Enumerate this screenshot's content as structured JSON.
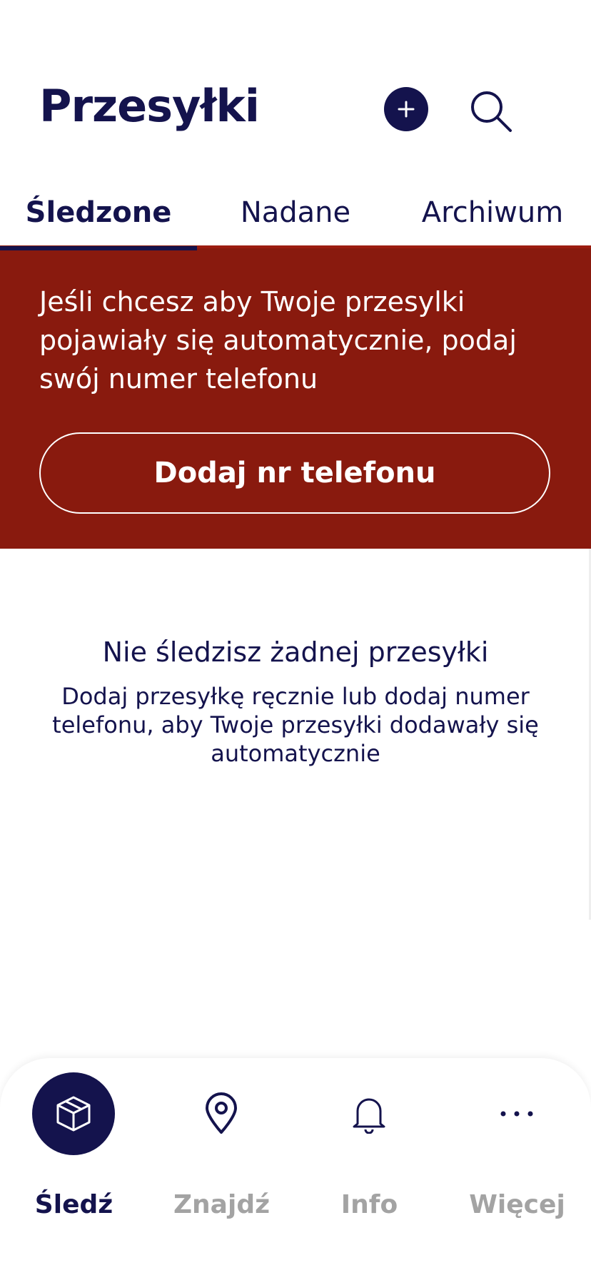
{
  "header": {
    "title": "Przesyłki"
  },
  "tabs": [
    {
      "label": "Śledzone",
      "active": true
    },
    {
      "label": "Nadane",
      "active": false
    },
    {
      "label": "Archiwum",
      "active": false
    }
  ],
  "banner": {
    "text": "Jeśli chcesz aby Twoje przesylki pojawiały się automatycznie, podaj swój numer telefonu",
    "button_label": "Dodaj nr telefonu",
    "background_color": "#891a0e"
  },
  "empty_state": {
    "title": "Nie śledzisz żadnej przesyłki",
    "description": "Dodaj przesyłkę ręcznie lub dodaj numer telefonu, aby Twoje przesyłki dodawały się automatycznie"
  },
  "bottom_nav": [
    {
      "label": "Śledź",
      "icon": "package-icon",
      "active": true
    },
    {
      "label": "Znajdź",
      "icon": "location-pin-icon",
      "active": false
    },
    {
      "label": "Info",
      "icon": "bell-icon",
      "active": false
    },
    {
      "label": "Więcej",
      "icon": "more-dots-icon",
      "active": false
    }
  ],
  "colors": {
    "primary": "#14134d",
    "inactive": "#a3a3a3",
    "background": "#ffffff"
  }
}
